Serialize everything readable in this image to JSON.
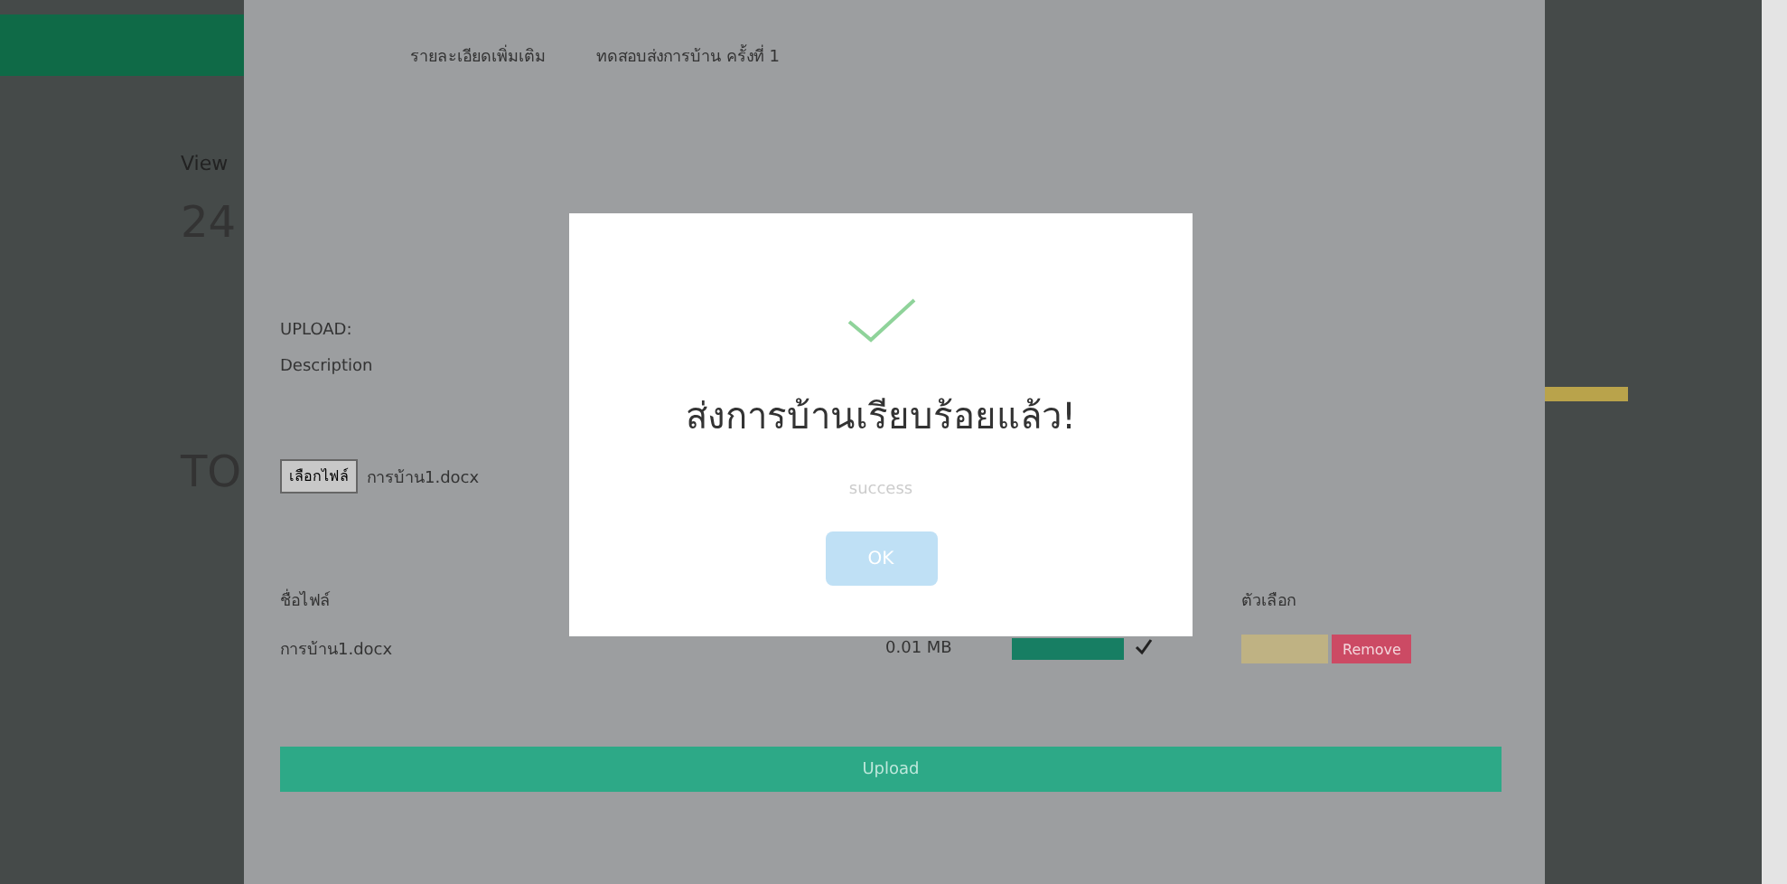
{
  "sidebar": {
    "texts": [
      "View",
      "24",
      "TO"
    ]
  },
  "nav": {
    "links": [
      "รายละเอียดเพิ่มเติม",
      "ทดสอบส่งการบ้าน ครั้งที่ 1"
    ]
  },
  "upload_form": {
    "label": "UPLOAD:",
    "description": "Description",
    "choose_button": "เลือกไฟล์",
    "chosen_file": "การบ้าน1.docx"
  },
  "file_table": {
    "columns": [
      "ชื่อไฟล์",
      "ตัวเลือก"
    ],
    "rows": [
      {
        "name": "การบ้าน1.docx",
        "size": "0.01 MB",
        "level": 1,
        "done": true,
        "remove": "Remove"
      }
    ]
  },
  "upload_button": "Upload",
  "dialog": {
    "title": "ส่งการบ้านเรียบร้อยแล้ว!",
    "message": "success",
    "button": "OK"
  }
}
